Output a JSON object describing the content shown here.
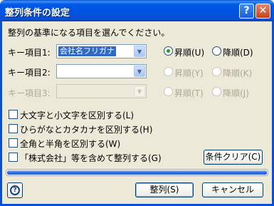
{
  "window": {
    "title": "整列条件の設定",
    "help_glyph": "?",
    "close_glyph": "✕"
  },
  "instruction": "整列の基準になる項目を選んでください。",
  "keys": [
    {
      "label": "キー項目1:",
      "value": "会社名フリガナ",
      "asc": "昇順(U)",
      "desc": "降順(D)",
      "enabled": true,
      "order": "asc"
    },
    {
      "label": "キー項目2:",
      "value": "",
      "asc": "昇順(Y)",
      "desc": "降順(K)",
      "enabled": false
    },
    {
      "label": "キー項目3:",
      "value": "",
      "asc": "昇順(T)",
      "desc": "降順(J)",
      "enabled": false
    }
  ],
  "options": [
    {
      "label": "大文字と小文字を区別する(L)",
      "checked": false
    },
    {
      "label": "ひらがなとカタカナを区別する(H)",
      "checked": false
    },
    {
      "label": "全角と半角を区別する(W)",
      "checked": false
    },
    {
      "label": "「株式会社」等を含めて整列する(G)",
      "checked": false
    }
  ],
  "buttons": {
    "clear": "条件クリア(C)",
    "sort": "整列(S)",
    "cancel": "キャンセル"
  },
  "progress": {
    "fraction": 1.0
  },
  "icons": {
    "help": "help-icon",
    "dropdown": "chevron-down-icon"
  },
  "colors": {
    "title_bar": "#0054e3",
    "selection": "#316ac5",
    "radio_dot": "#21a121",
    "progress": "#3169e6"
  }
}
